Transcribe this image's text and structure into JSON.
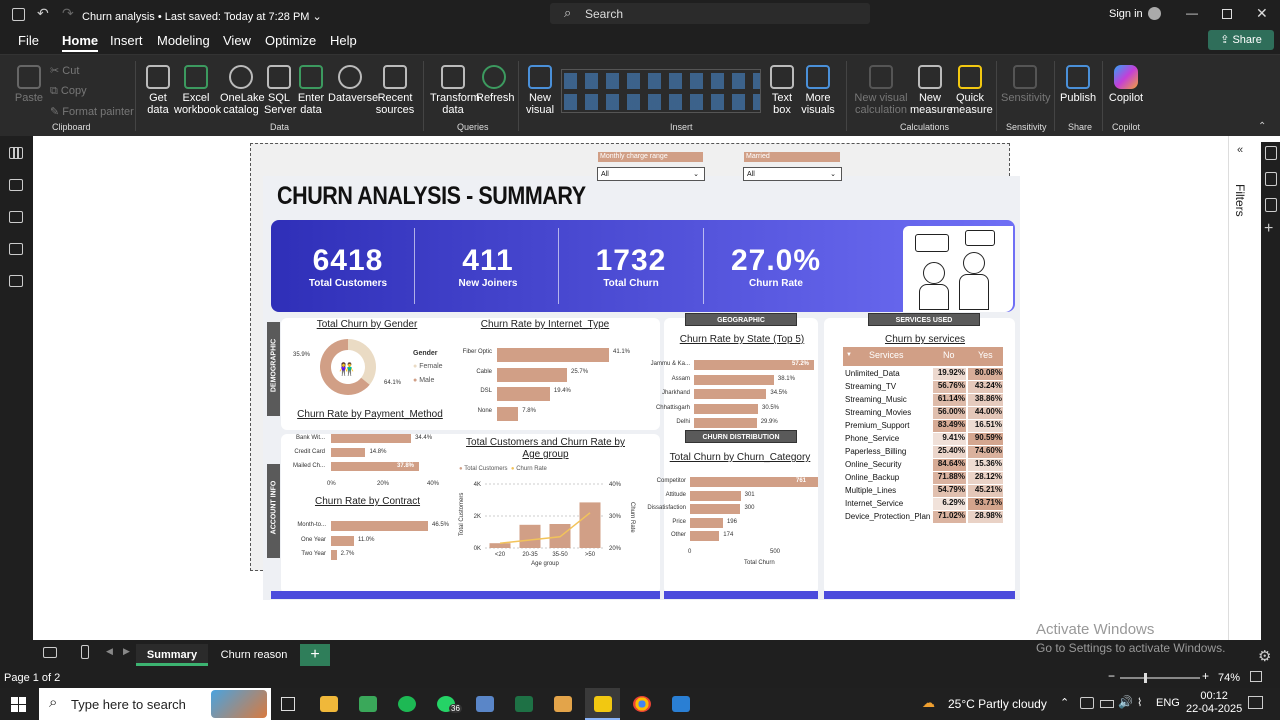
{
  "window": {
    "title": "Churn analysis",
    "saved_status": "• Last saved: Today at 7:28 PM",
    "search_placeholder": "Search",
    "sign_in": "Sign in"
  },
  "menu": {
    "items": [
      "File",
      "Home",
      "Insert",
      "Modeling",
      "View",
      "Optimize",
      "Help"
    ],
    "active": "Home",
    "share": "Share"
  },
  "ribbon": {
    "clipboard": {
      "paste": "Paste",
      "cut": "Cut",
      "copy": "Copy",
      "format_painter": "Format painter",
      "group": "Clipboard"
    },
    "data": {
      "get_data": "Get data",
      "excel": "Excel workbook",
      "onelake": "OneLake catalog",
      "sql": "SQL Server",
      "enter": "Enter data",
      "dataverse": "Dataverse",
      "recent": "Recent sources",
      "group": "Data"
    },
    "queries": {
      "transform": "Transform data",
      "refresh": "Refresh",
      "group": "Queries"
    },
    "insert": {
      "new_visual": "New visual",
      "text_box": "Text box",
      "more_visuals": "More visuals",
      "group": "Insert"
    },
    "calculations": {
      "new_visual_calc": "New visual calculation",
      "new_measure": "New measure",
      "quick_measure": "Quick measure",
      "group": "Calculations"
    },
    "sensitivity": {
      "label": "Sensitivity",
      "group": "Sensitivity"
    },
    "share": {
      "publish": "Publish",
      "group": "Share"
    },
    "copilot": {
      "label": "Copilot",
      "group": "Copilot"
    }
  },
  "filters_pane": {
    "label": "Filters"
  },
  "report": {
    "title": "CHURN ANALYSIS - SUMMARY",
    "slicers": [
      {
        "label": "Monthly charge range",
        "value": "All"
      },
      {
        "label": "Married",
        "value": "All"
      }
    ],
    "kpis": [
      {
        "value": "6418",
        "label": "Total Customers"
      },
      {
        "value": "411",
        "label": "New Joiners"
      },
      {
        "value": "1732",
        "label": "Total Churn"
      },
      {
        "value": "27.0%",
        "label": "Churn Rate"
      }
    ],
    "section_labels": {
      "demographic": "DEMOGRAPHIC",
      "account_info": "ACCOUNT INFO",
      "geographic": "GEOGRAPHIC",
      "churn_distribution": "CHURN DISTRIBUTION",
      "services_used": "SERVICES USED"
    }
  },
  "chart_data": [
    {
      "type": "pie",
      "title": "Total Churn by Gender",
      "legend_title": "Gender",
      "categories": [
        "Female",
        "Male"
      ],
      "values": [
        35.9,
        64.1
      ],
      "value_labels": [
        "35.9%",
        "64.1%"
      ]
    },
    {
      "type": "bar",
      "title": "Churn Rate by Internet_Type",
      "categories": [
        "Fiber Optic",
        "Cable",
        "DSL",
        "None"
      ],
      "values": [
        41.1,
        25.7,
        19.4,
        7.8
      ],
      "value_labels": [
        "41.1%",
        "25.7%",
        "19.4%",
        "7.8%"
      ]
    },
    {
      "type": "bar",
      "title": "Churn Rate by Payment_Method",
      "categories": [
        "Bank Wit...",
        "Credit Card",
        "Mailed Ch..."
      ],
      "values": [
        34.4,
        14.8,
        37.8
      ],
      "value_labels": [
        "34.4%",
        "14.8%",
        "37.8%"
      ],
      "x_ticks": [
        "0%",
        "20%",
        "40%"
      ]
    },
    {
      "type": "bar",
      "title": "Churn Rate by Contract",
      "categories": [
        "Month-to...",
        "One Year",
        "Two Year"
      ],
      "values": [
        46.5,
        11.0,
        2.7
      ],
      "value_labels": [
        "46.5%",
        "11.0%",
        "2.7%"
      ]
    },
    {
      "type": "bar",
      "title": "Total Customers and Churn Rate by Age group",
      "xlabel": "Age group",
      "ylabel": "Total Customers",
      "y2label": "Churn Rate",
      "categories": [
        "<20",
        "20-35",
        "35-50",
        ">50"
      ],
      "series": [
        {
          "name": "Total Customers",
          "values": [
            300,
            1450,
            1500,
            2850
          ]
        },
        {
          "name": "Churn Rate",
          "values": [
            21.5,
            22.5,
            23.5,
            31
          ]
        }
      ],
      "y_ticks": [
        "0K",
        "2K",
        "4K"
      ],
      "y2_ticks": [
        "20%",
        "30%",
        "40%"
      ],
      "ylim": [
        0,
        4000
      ],
      "y2lim": [
        20,
        40
      ]
    },
    {
      "type": "bar",
      "title": "Churn Rate by State (Top 5)",
      "categories": [
        "Jammu & Ka...",
        "Assam",
        "Jharkhand",
        "Chhattisgarh",
        "Delhi"
      ],
      "values": [
        57.2,
        38.1,
        34.5,
        30.5,
        29.9
      ],
      "value_labels": [
        "57.2%",
        "38.1%",
        "34.5%",
        "30.5%",
        "29.9%"
      ]
    },
    {
      "type": "bar",
      "title": "Total Churn by Churn_Category",
      "xlabel": "Total Churn",
      "categories": [
        "Competitor",
        "Attitude",
        "Dissatisfaction",
        "Price",
        "Other"
      ],
      "values": [
        761,
        301,
        300,
        196,
        174
      ],
      "value_labels": [
        "761",
        "301",
        "300",
        "196",
        "174"
      ],
      "x_ticks": [
        "0",
        "500"
      ]
    },
    {
      "type": "table",
      "title": "Churn by services",
      "columns": [
        "Services",
        "No",
        "Yes"
      ],
      "rows": [
        [
          "Unlimited_Data",
          "19.92%",
          "80.08%"
        ],
        [
          "Streaming_TV",
          "56.76%",
          "43.24%"
        ],
        [
          "Streaming_Music",
          "61.14%",
          "38.86%"
        ],
        [
          "Streaming_Movies",
          "56.00%",
          "44.00%"
        ],
        [
          "Premium_Support",
          "83.49%",
          "16.51%"
        ],
        [
          "Phone_Service",
          "9.41%",
          "90.59%"
        ],
        [
          "Paperless_Billing",
          "25.40%",
          "74.60%"
        ],
        [
          "Online_Security",
          "84.64%",
          "15.36%"
        ],
        [
          "Online_Backup",
          "71.88%",
          "28.12%"
        ],
        [
          "Multiple_Lines",
          "54.79%",
          "45.21%"
        ],
        [
          "Internet_Service",
          "6.29%",
          "93.71%"
        ],
        [
          "Device_Protection_Plan",
          "71.02%",
          "28.98%"
        ]
      ]
    }
  ],
  "page_tabs": [
    "Summary",
    "Churn reason"
  ],
  "active_tab": "Summary",
  "status": {
    "page": "Page 1 of 2",
    "zoom": "74%",
    "activate_title": "Activate Windows",
    "activate_sub": "Go to Settings to activate Windows."
  },
  "taskbar": {
    "search": "Type here to search",
    "weather": "25°C  Partly cloudy",
    "lang": "ENG",
    "time": "00:12",
    "date": "22-04-2025",
    "whatsapp_badge": "36"
  },
  "colors": {
    "accent": "#d19f86",
    "kpi_start": "#2f2fb8",
    "kpi_end": "#6f6ff5",
    "power_bi_yellow": "#f2c811"
  }
}
